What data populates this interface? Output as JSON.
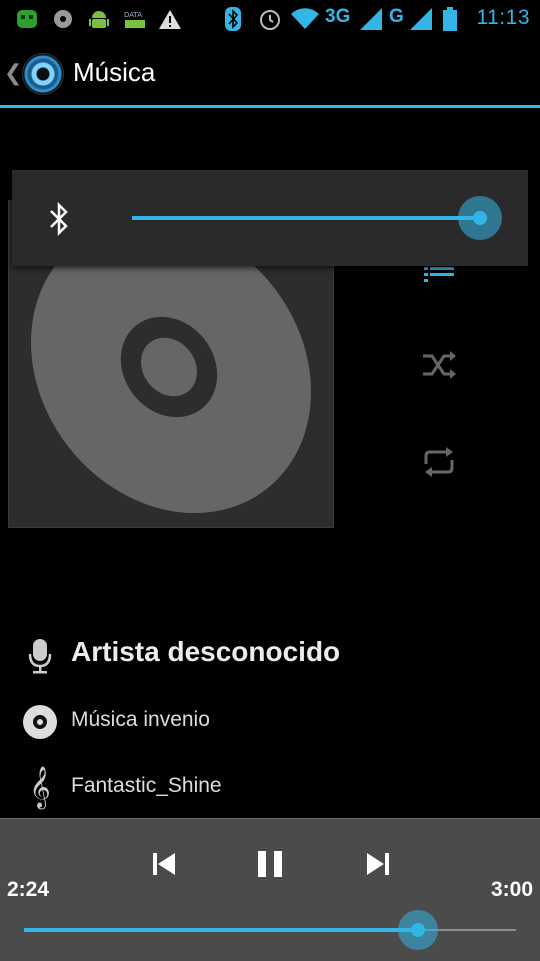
{
  "status_bar": {
    "time": "11:13",
    "network_1": "3G",
    "network_2": "G",
    "icons": [
      "android-icon",
      "settings-icon",
      "android-debug-icon",
      "data-icon",
      "warning-icon",
      "bluetooth-icon",
      "alarm-icon",
      "wifi-icon",
      "signal-icon",
      "signal-icon",
      "battery-icon"
    ]
  },
  "action_bar": {
    "title": "Música"
  },
  "volume": {
    "icon": "bluetooth-icon",
    "level": 1.0
  },
  "track": {
    "artist": "Artista desconocido",
    "album": "Música invenio",
    "title": "Fantastic_Shine"
  },
  "playback": {
    "elapsed": "2:24",
    "duration": "3:00",
    "progress": 0.8,
    "state": "playing"
  },
  "colors": {
    "accent": "#33b5e5",
    "panel": "#4b4b4b",
    "volume_panel": "#2a2a2a"
  }
}
